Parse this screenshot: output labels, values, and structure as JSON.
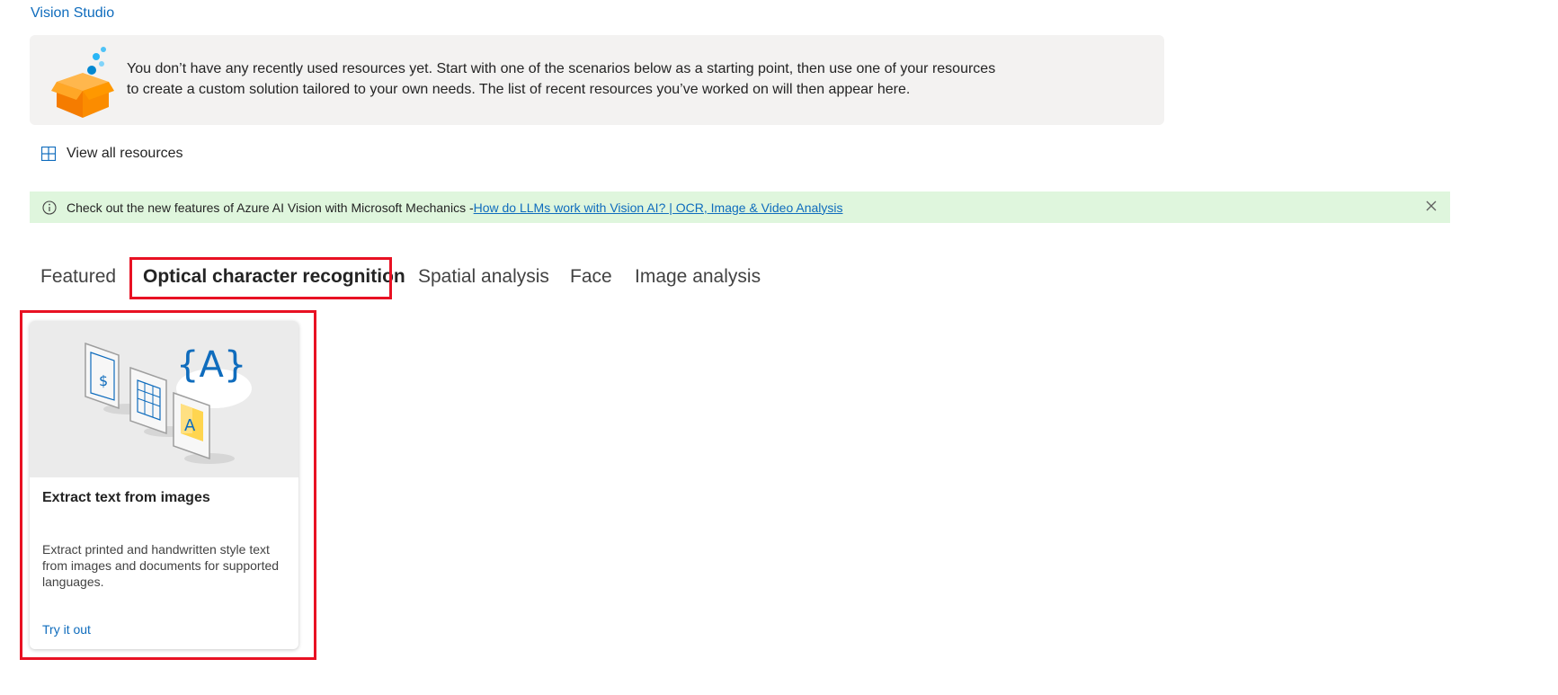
{
  "header": {
    "brand": "Vision Studio"
  },
  "empty_state": {
    "line1": "You don’t have any recently used resources yet. Start with one of the scenarios below as a starting point, then use one of your resources",
    "line2": "to create a custom solution tailored to your own needs. The list of recent resources you’ve worked on will then appear here."
  },
  "view_all": {
    "label": "View all resources",
    "icon": "grid-icon"
  },
  "info_bar": {
    "text": "Check out the new features of Azure AI Vision with Microsoft Mechanics - ",
    "link": "How do LLMs work with Vision AI? | OCR, Image & Video Analysis",
    "background": "#dff6dd"
  },
  "tabs": [
    {
      "label": "Featured",
      "active": false
    },
    {
      "label": "Optical character recognition",
      "active": true
    },
    {
      "label": "Spatial analysis",
      "active": false
    },
    {
      "label": "Face",
      "active": false
    },
    {
      "label": "Image analysis",
      "active": false
    }
  ],
  "card": {
    "title": "Extract text from images",
    "description": "Extract printed and handwritten style text from images and documents for supported languages.",
    "link": "Try it out"
  },
  "colors": {
    "accent": "#0f6cbd",
    "highlight": "#e81123"
  }
}
